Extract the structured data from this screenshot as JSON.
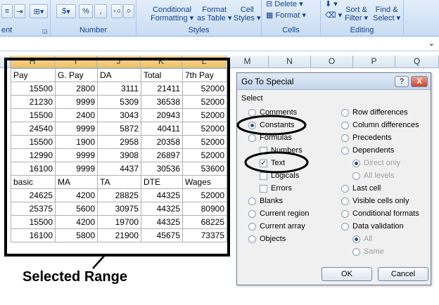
{
  "ribbon": {
    "alignment_label": "ent",
    "number_label": "Number",
    "number_buttons": [
      "$",
      "%",
      ",",
      ".0/.00",
      ".00/.0"
    ],
    "styles_label": "Styles",
    "conditional_formatting": [
      "Conditional",
      "Formatting"
    ],
    "format_as_table": [
      "Format",
      "as Table"
    ],
    "cell_styles": [
      "Cell",
      "Styles"
    ],
    "cells_label": "Cells",
    "delete_label": "Delete",
    "format_label": "Format",
    "editing_label": "Editing",
    "sort_filter": [
      "Sort &",
      "Filter"
    ],
    "find_select": [
      "Find &",
      "Select"
    ]
  },
  "columns": [
    "H",
    "I",
    "J",
    "K",
    "L",
    "M",
    "N",
    "O",
    "P",
    "Q"
  ],
  "table_rows": [
    [
      "Pay",
      "G. Pay",
      "DA",
      "Total",
      "7th Pay"
    ],
    [
      "15500",
      "2800",
      "3111",
      "21411",
      "52000"
    ],
    [
      "21230",
      "9999",
      "5309",
      "36538",
      "52000"
    ],
    [
      "15500",
      "2400",
      "3043",
      "20943",
      "52000"
    ],
    [
      "24540",
      "9999",
      "5872",
      "40411",
      "52000"
    ],
    [
      "15500",
      "1900",
      "2958",
      "20358",
      "52000"
    ],
    [
      "12990",
      "9999",
      "3908",
      "26897",
      "52000"
    ],
    [
      "16100",
      "9999",
      "4437",
      "30536",
      "53600"
    ],
    [
      "basic",
      "MA",
      "TA",
      "DTE",
      "Wages"
    ],
    [
      "24625",
      "4200",
      "28825",
      "44325",
      "52000"
    ],
    [
      "25375",
      "5600",
      "30975",
      "44325",
      "80900"
    ],
    [
      "15500",
      "4200",
      "19700",
      "44325",
      "68225"
    ],
    [
      "16100",
      "5800",
      "21900",
      "45675",
      "73375"
    ]
  ],
  "annotation": "Selected Range",
  "dialog": {
    "title": "Go To Special",
    "help": "?",
    "close": "X",
    "select_label": "Select",
    "left_options": [
      "Comments",
      "Constants",
      "Formulas",
      "Numbers",
      "Text",
      "Logicals",
      "Errors",
      "Blanks",
      "Current region",
      "Current array",
      "Objects"
    ],
    "right_options": [
      "Row differences",
      "Column differences",
      "Precedents",
      "Dependents",
      "Direct only",
      "All levels",
      "Last cell",
      "Visible cells only",
      "Conditional formats",
      "Data validation",
      "All",
      "Same"
    ],
    "ok": "OK",
    "cancel": "Cancel"
  },
  "colors": {
    "ribbon_text": "#15428b",
    "selected_header": "#f1c15f",
    "radio_selected": "#2a4f8b"
  }
}
